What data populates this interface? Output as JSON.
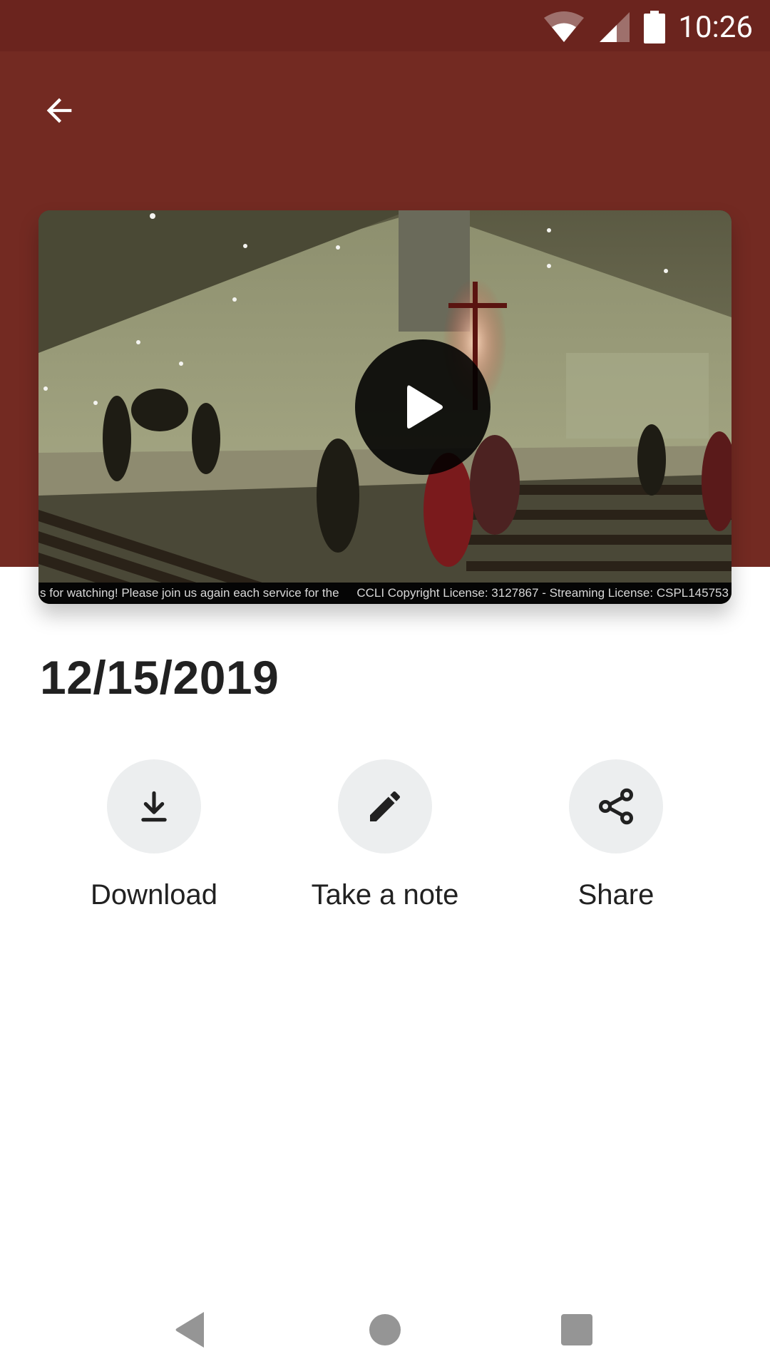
{
  "status_bar": {
    "time": "10:26",
    "icons": [
      "wifi-icon",
      "cellular-signal-icon",
      "battery-icon"
    ]
  },
  "toolbar": {
    "back_icon": "arrow-left-icon"
  },
  "video": {
    "play_icon": "play-icon",
    "ticker_left": "s for watching! Please join us again each service for the",
    "ticker_right": "CCLI Copyright License: 3127867 - Streaming License: CSPL145753"
  },
  "detail": {
    "date": "12/15/2019"
  },
  "actions": [
    {
      "label": "Download",
      "icon": "download-icon"
    },
    {
      "label": "Take a note",
      "icon": "pencil-icon"
    },
    {
      "label": "Share",
      "icon": "share-icon"
    }
  ],
  "nav": {
    "back": "nav-back-icon",
    "home": "nav-home-icon",
    "recents": "nav-recents-icon"
  },
  "colors": {
    "header": "#732a22",
    "status_bar": "#6b241e",
    "action_circle": "#eceeef",
    "text_primary": "#212121",
    "nav_icon": "#959595"
  }
}
